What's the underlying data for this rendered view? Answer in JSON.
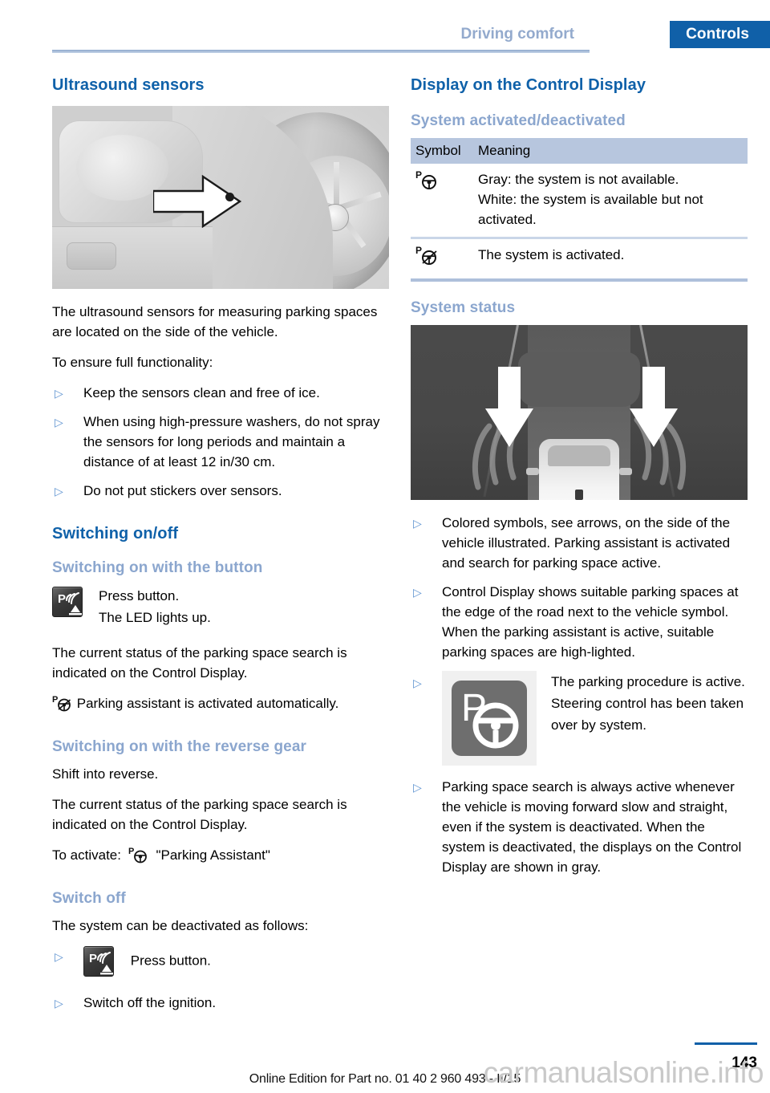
{
  "header": {
    "chapter": "Driving comfort",
    "section": "Controls"
  },
  "left_column": {
    "heading": "Ultrasound sensors",
    "figure_alt": "ultrasound-sensor-on-vehicle-side",
    "paragraph_1": "The ultrasound sensors for measuring parking spaces are located on the side of the vehicle.",
    "paragraph_2": "To ensure full functionality:",
    "bullets": [
      "Keep the sensors clean and free of ice.",
      "When using high-pressure washers, do not spray the sensors for long periods and maintain a distance of at least 12 in/30 cm.",
      "Do not put stickers over sensors."
    ],
    "switching_heading": "Switching on/off",
    "button_sub": "Switching on with the button",
    "button_press": "Press button.",
    "button_led": "The LED lights up.",
    "status_para": "The current status of the parking space search is indicated on the Control Display.",
    "auto_activated": "Parking assistant is activated automatically.",
    "reverse_sub": "Switching on with the reverse gear",
    "reverse_line": "Shift into reverse.",
    "reverse_status": "The current status of the parking space search is indicated on the Control Display.",
    "to_activate_prefix": "To activate:",
    "to_activate_label": "\"Parking Assistant\"",
    "switch_off_sub": "Switch off",
    "switch_off_intro": "The system can be deactivated as follows:",
    "switch_off_bullets": [
      "Press button.",
      "Switch off the ignition."
    ]
  },
  "right_column": {
    "heading": "Display on the Control Display",
    "sub_activated": "System activated/deactivated",
    "table": {
      "columns": [
        "Symbol",
        "Meaning"
      ],
      "rows": [
        {
          "symbol": "parking-assistant-wheel-icon",
          "lines": [
            "Gray: the system is not available.",
            "White: the system is available but not activated."
          ]
        },
        {
          "symbol": "parking-assistant-wheel-active-icon",
          "lines": [
            "The system is activated."
          ]
        }
      ]
    },
    "sub_status": "System status",
    "figure_alt": "control-display-parking-space-search",
    "bullets": [
      "Colored symbols, see arrows, on the side of the vehicle illustrated. Parking assistant is activated and search for parking space active.",
      "Control Display shows suitable parking spaces at the edge of the road next to the vehicle symbol. When the parking assistant is active, suitable parking spaces are high-lighted."
    ],
    "tile_text": "The parking procedure is active. Steering control has been taken over by system.",
    "last_bullet": "Parking space search is always active whenever the vehicle is moving forward slow and straight, even if the system is deactivated. When the system is deactivated, the displays on the Control Display are shown in gray."
  },
  "footer": {
    "edition": "Online Edition for Part no. 01 40 2 960 493 - II/15",
    "page_number": "143",
    "watermark": "carmanualsonline.info"
  },
  "colors": {
    "accent_blue": "#1060a8",
    "sub_blue": "#8ba6ce",
    "table_header": "#b7c6de",
    "bullet_blue": "#5d92d0"
  }
}
